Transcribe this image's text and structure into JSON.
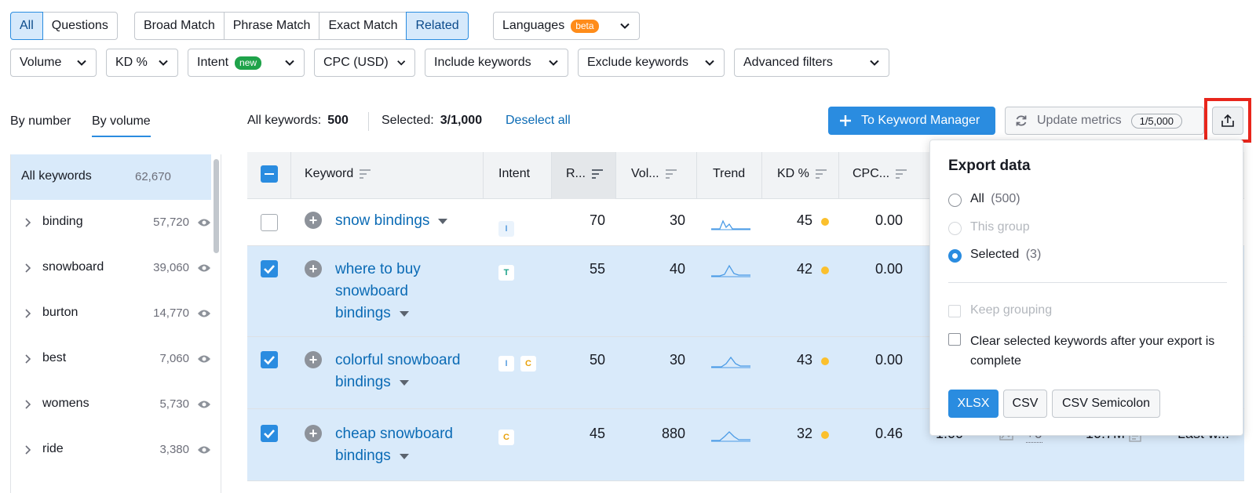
{
  "colors": {
    "accent": "#2a8ce0",
    "link": "#0b6bb5",
    "highlight": "#e8261c",
    "kd_dot": "#fbc02d"
  },
  "tabs_match": [
    "All",
    "Questions"
  ],
  "tabs_type": [
    "Broad Match",
    "Phrase Match",
    "Exact Match",
    "Related"
  ],
  "languages": {
    "label": "Languages",
    "badge": "beta"
  },
  "filters": {
    "volume": "Volume",
    "kd": "KD %",
    "intent": "Intent",
    "intent_badge": "new",
    "cpc": "CPC (USD)",
    "include": "Include keywords",
    "exclude": "Exclude keywords",
    "advanced": "Advanced filters"
  },
  "side_tabs": {
    "by_number": "By number",
    "by_volume": "By volume"
  },
  "summary": {
    "all_label": "All keywords:",
    "all_value": "500",
    "selected_label": "Selected:",
    "selected_value": "3/1,000",
    "deselect": "Deselect all"
  },
  "actions": {
    "to_manager": "To Keyword Manager",
    "update_metrics": "Update metrics",
    "update_count": "1/5,000"
  },
  "sidebar": {
    "all": {
      "label": "All keywords",
      "count": "62,670"
    },
    "items": [
      {
        "label": "binding",
        "count": "57,720"
      },
      {
        "label": "snowboard",
        "count": "39,060"
      },
      {
        "label": "burton",
        "count": "14,770"
      },
      {
        "label": "best",
        "count": "7,060"
      },
      {
        "label": "womens",
        "count": "5,730"
      },
      {
        "label": "ride",
        "count": "3,380"
      }
    ]
  },
  "table": {
    "headers": {
      "keyword": "Keyword",
      "intent": "Intent",
      "rank": "R...",
      "volume": "Vol...",
      "trend": "Trend",
      "kd": "KD %",
      "cpc": "CPC..."
    },
    "rows": [
      {
        "keyword": [
          "snow bindings"
        ],
        "intents": [
          "I"
        ],
        "rank": "70",
        "volume": "30",
        "kd": "45",
        "cpc": "0.00",
        "selected": false
      },
      {
        "keyword": [
          "where to buy",
          "snowboard",
          "bindings"
        ],
        "intents": [
          "T"
        ],
        "rank": "55",
        "volume": "40",
        "kd": "42",
        "cpc": "0.00",
        "selected": true
      },
      {
        "keyword": [
          "colorful snowboard",
          "bindings"
        ],
        "intents": [
          "I",
          "C"
        ],
        "rank": "50",
        "volume": "30",
        "kd": "43",
        "cpc": "0.00",
        "selected": true
      },
      {
        "keyword": [
          "cheap snowboard",
          "bindings"
        ],
        "intents": [
          "C"
        ],
        "rank": "45",
        "volume": "880",
        "kd": "32",
        "cpc": "0.46",
        "selected": true,
        "extra": {
          "com": "1.00",
          "serp": "+6",
          "results": "10.7M",
          "updated": "Last w..."
        }
      }
    ]
  },
  "export": {
    "title": "Export data",
    "options": [
      {
        "label": "All",
        "count": "(500)"
      },
      {
        "label": "This group",
        "count": ""
      },
      {
        "label": "Selected",
        "count": "(3)"
      }
    ],
    "keep_grouping": "Keep grouping",
    "clear_selected": "Clear selected keywords after your export is complete",
    "formats": [
      "XLSX",
      "CSV",
      "CSV Semicolon"
    ]
  }
}
